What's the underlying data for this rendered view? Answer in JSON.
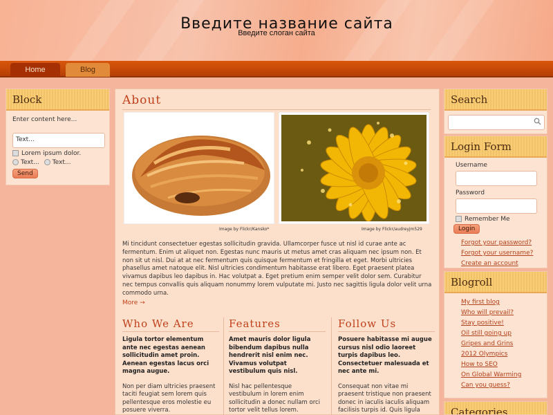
{
  "site": {
    "title": "Введите название сайта",
    "slogan": "Введите слоган сайта"
  },
  "menu": {
    "items": [
      {
        "label": "Home",
        "active": true
      },
      {
        "label": "Blog",
        "active": false
      }
    ]
  },
  "block": {
    "title": "Block",
    "text": "Enter content here...",
    "input_value": "Text...",
    "checkbox_label": "Lorem ipsum dolor.",
    "radio1": "Text...",
    "radio2": "Text...",
    "send_label": "Send"
  },
  "about": {
    "title": "About",
    "caption1": "Image by Flickr/Kansko*",
    "caption2": "Image by Flickr/audreyjm529",
    "text": "Mi tincidunt consectetuer egestas sollicitudin gravida. Ullamcorper fusce ut nisl id curae ante ac fermentum. Enim ut aliquet non. Egestas nunc mauris ut metus amet cras aliquam nec ipsum non. Et non sit ut nisl. Dui at at nec fermentum quis quisque fermentum et fringilla et eget. Morbi ultricies phasellus amet natoque elit. Nisl ultricies condimentum habitasse erat libero. Eget praesent platea vivamus dapibus leo dapibus in. Hac volutpat a. Eget pretium enim semper velit dolor sem. Curabitur nec tempus convallis quis aliquam nonummy lorem vulputate mi. Justo nec sagittis ligula dolor velit urna commodo urna.",
    "more": "More →"
  },
  "columns": [
    {
      "title": "Who We Are",
      "strong": "Ligula tortor elementum ante nec egestas aenean sollicitudin amet proin. Aenean egestas lacus orci magna augue.",
      "plain": "Non per diam ultricies praesent taciti feugiat sem lorem quis pellentesque eros molestie eu posuere viverra."
    },
    {
      "title": "Features",
      "strong": "Amet mauris dolor ligula bibendum dapibus nulla hendrerit nisl enim nec. Vivamus volutpat vestibulum quis nisl.",
      "plain": "Nisl hac pellentesque vestibulum in lorem enim sollicitudin a donec nullam orci tortor velit tellus lorem."
    },
    {
      "title": "Follow Us",
      "strong": "Posuere habitasse mi augue cursus nisl odio laoreet turpis dapibus leo. Consectetuer malesuada et nec ante mi.",
      "plain": "Consequat non vitae mi praesent tristique non praesent donec in iaculis iaculis aliquam facilisis turpis id. Quis ligula gravida lobortis."
    }
  ],
  "search": {
    "title": "Search",
    "placeholder": ""
  },
  "login": {
    "title": "Login Form",
    "username_label": "Username",
    "password_label": "Password",
    "remember_label": "Remember Me",
    "login_button": "Login",
    "forgot_password": "Forgot your password?",
    "forgot_username": "Forgot your username?",
    "create_account": "Create an account"
  },
  "blogroll": {
    "title": "Blogroll",
    "links": [
      "My first blog",
      "Who will prevail?",
      "Stay positive!",
      "Oil still going up",
      "Gripes and Grins",
      "2012 Olympics",
      "How to SEO",
      "On Global Warming",
      "Can you guess?"
    ]
  },
  "categories": {
    "title": "Categories"
  },
  "colors": {
    "menu_bar": "#c9490a",
    "accent": "#c0401a",
    "box_header": "#f7cd78"
  }
}
